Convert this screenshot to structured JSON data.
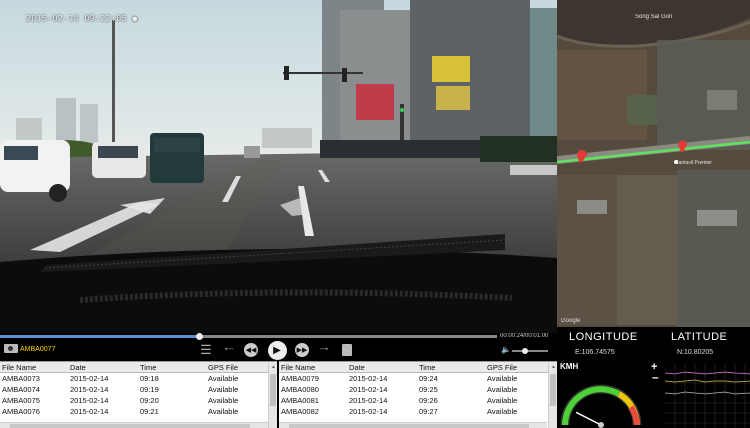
{
  "video": {
    "osd_timestamp": "2015-02-14 09:22:05 ●"
  },
  "map": {
    "river_label": "Song Sai Gon",
    "road_label": "Cantavil Premier",
    "copyright": "Google"
  },
  "gps": {
    "longitude_label": "LONGITUDE",
    "latitude_label": "LATITUDE",
    "longitude_value": "E:106.74575",
    "latitude_value": "N:10.80205"
  },
  "playback": {
    "time_readout": "00:00:24/00:01:00",
    "current_file": "AMBA0077",
    "progress_fraction": 0.4,
    "volume_fraction": 0.35
  },
  "icons": {
    "camera": "camera-icon",
    "list": "list-icon",
    "prev": "previous-icon",
    "rewind": "rewind-icon",
    "play": "play-icon",
    "forward": "fast-forward-icon",
    "next": "next-icon",
    "save": "save-icon",
    "volume": "volume-icon"
  },
  "tables": {
    "headers": [
      "File Name",
      "Date",
      "Time",
      "GPS File"
    ],
    "left": [
      [
        "AMBA0073",
        "2015-02-14",
        "09:18",
        "Available"
      ],
      [
        "AMBA0074",
        "2015-02-14",
        "09:19",
        "Available"
      ],
      [
        "AMBA0075",
        "2015-02-14",
        "09:20",
        "Available"
      ],
      [
        "AMBA0076",
        "2015-02-14",
        "09:21",
        "Available"
      ]
    ],
    "right": [
      [
        "AMBA0079",
        "2015-02-14",
        "09:24",
        "Available"
      ],
      [
        "AMBA0080",
        "2015-02-14",
        "09:25",
        "Available"
      ],
      [
        "AMBA0081",
        "2015-02-14",
        "09:26",
        "Available"
      ],
      [
        "AMBA0082",
        "2015-02-14",
        "09:27",
        "Available"
      ]
    ]
  },
  "speed": {
    "unit_label": "KMH",
    "value": 30,
    "max": 200
  },
  "zoom": {
    "plus": "+",
    "minus": "–"
  },
  "colors": {
    "accent_file": "#ffd000",
    "route": "#5fe35f",
    "gauge_green": "#4cd137"
  }
}
